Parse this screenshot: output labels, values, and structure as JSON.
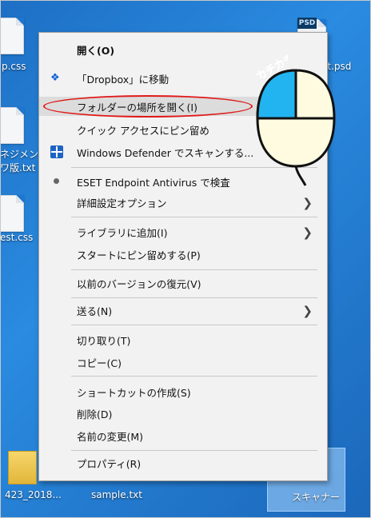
{
  "desktop": {
    "icons": [
      {
        "label": "p.css"
      },
      {
        "label": "ネジメント"
      },
      {
        "label": "ワ版.txt"
      },
      {
        "label": "est.css"
      },
      {
        "label": "423_2018..."
      },
      {
        "label": "sample.txt"
      },
      {
        "label": "スキャナー"
      },
      {
        "label": "et.psd"
      }
    ],
    "psd_badge": "PSD"
  },
  "context_menu": {
    "items": [
      {
        "label": "開く(O)"
      },
      {
        "label": "「Dropbox」に移動"
      },
      {
        "label": "フォルダーの場所を開く(I)"
      },
      {
        "label": "クイック アクセスにピン留め"
      },
      {
        "label": "Windows Defender でスキャンする..."
      },
      {
        "label": "ESET Endpoint Antivirus で検査"
      },
      {
        "label": "詳細設定オプション"
      },
      {
        "label": "ライブラリに追加(I)"
      },
      {
        "label": "スタートにピン留めする(P)"
      },
      {
        "label": "以前のバージョンの復元(V)"
      },
      {
        "label": "送る(N)"
      },
      {
        "label": "切り取り(T)"
      },
      {
        "label": "コピー(C)"
      },
      {
        "label": "ショートカットの作成(S)"
      },
      {
        "label": "削除(D)"
      },
      {
        "label": "名前の変更(M)"
      },
      {
        "label": "プロパティ(R)"
      }
    ]
  },
  "annotation": {
    "click_text": "カチカチ",
    "highlight_color": "#e01a1a",
    "mouse_button_color": "#22b4f0",
    "mouse_body_color": "#fefbe0"
  },
  "colors": {
    "desktop_bg": "#2a8be0",
    "menu_bg": "#f2f2f2"
  }
}
